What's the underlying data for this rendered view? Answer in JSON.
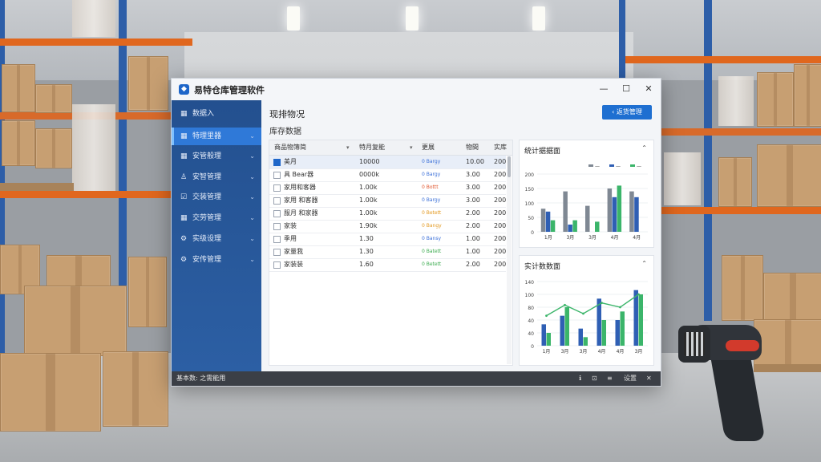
{
  "window": {
    "title": "易特仓库管理软件",
    "controls": [
      "—",
      "☐",
      "✕"
    ]
  },
  "sidebar": {
    "items": [
      {
        "label": "数据入",
        "icon": "grid-icon",
        "active": false
      },
      {
        "label": "特理里器",
        "icon": "grid-icon",
        "active": true
      },
      {
        "label": "安管般理",
        "icon": "grid-icon",
        "active": false
      },
      {
        "label": "安智管理",
        "icon": "user-icon",
        "active": false
      },
      {
        "label": "交装管理",
        "icon": "check-icon",
        "active": false
      },
      {
        "label": "交劳管理",
        "icon": "grid-icon",
        "active": false
      },
      {
        "label": "实级设理",
        "icon": "gear-icon",
        "active": false
      },
      {
        "label": "安传管理",
        "icon": "gear-icon",
        "active": false
      }
    ]
  },
  "main": {
    "title": "现排物况",
    "subtitle": "库存数据",
    "back_button": "返货管理"
  },
  "table": {
    "columns": [
      "商品物簿简",
      "特月复能",
      "更展",
      "物間",
      "实库"
    ],
    "rows": [
      {
        "name": "美月",
        "value": "10000",
        "status": "0 Bargy",
        "status_color": "#3a6fd8",
        "date": "10.00",
        "qty": "200",
        "checked": true
      },
      {
        "name": "具 Bear器",
        "value": "0000k",
        "status": "0 Bargy",
        "status_color": "#3a6fd8",
        "date": "3.00",
        "qty": "200",
        "checked": false
      },
      {
        "name": "家用和客器",
        "value": "1.00k",
        "status": "0 Bottt",
        "status_color": "#e0542c",
        "date": "3.00",
        "qty": "200",
        "checked": false
      },
      {
        "name": "家用 和客器",
        "value": "1.00k",
        "status": "0 Bargy",
        "status_color": "#3a6fd8",
        "date": "3.00",
        "qty": "200",
        "checked": false
      },
      {
        "name": "服月 和家器",
        "value": "1.00k",
        "status": "0 Betett",
        "status_color": "#e39a22",
        "date": "2.00",
        "qty": "200",
        "checked": false
      },
      {
        "name": "家装",
        "value": "1.90k",
        "status": "0 Bangy",
        "status_color": "#e39a22",
        "date": "2.00",
        "qty": "200",
        "checked": false
      },
      {
        "name": "季用",
        "value": "1.30",
        "status": "0 Bansy",
        "status_color": "#3a6fd8",
        "date": "1.00",
        "qty": "200",
        "checked": false
      },
      {
        "name": "家量我",
        "value": "1.30",
        "status": "0 Batett",
        "status_color": "#3bab4f",
        "date": "1.00",
        "qty": "200",
        "checked": false
      },
      {
        "name": "家装装",
        "value": "1.60",
        "status": "0 Betett",
        "status_color": "#3bab4f",
        "date": "2.00",
        "qty": "200",
        "checked": false
      }
    ]
  },
  "statusbar": {
    "text": "基本数: 之需能用",
    "icons": [
      "ℹ",
      "⊡",
      "≡",
      "设置",
      "✕"
    ]
  },
  "charts": {
    "top_title": "统计据据面",
    "bottom_title": "实计数数面"
  },
  "chart_data": [
    {
      "type": "bar",
      "title": "统计据据面",
      "categories": [
        "1月",
        "3月",
        "3月",
        "4月",
        "4月"
      ],
      "ylim": [
        0,
        200
      ],
      "yticks": [
        0,
        50,
        100,
        150,
        200
      ],
      "legend": [
        "—",
        "—",
        "—"
      ],
      "legend_placement": "top-right",
      "series": [
        {
          "color": "#7f8893",
          "values": [
            80,
            140,
            90,
            150,
            140
          ]
        },
        {
          "color": "#2f5fb4",
          "values": [
            70,
            25,
            0,
            120,
            120
          ]
        },
        {
          "color": "#3bb56a",
          "values": [
            40,
            40,
            35,
            160,
            0
          ]
        }
      ]
    },
    {
      "type": "bar+line",
      "title": "实计数数面",
      "categories": [
        "1月",
        "3月",
        "3月",
        "4月",
        "4月",
        "3月"
      ],
      "ylim": [
        0,
        150
      ],
      "yticks": [
        0,
        50,
        100,
        150
      ],
      "ytick_labels": [
        "0",
        "40",
        "40",
        "80",
        "100",
        "140"
      ],
      "series": [
        {
          "color": "#2f5fb4",
          "values": [
            50,
            70,
            40,
            110,
            60,
            130
          ]
        },
        {
          "color": "#3bb56a",
          "values": [
            30,
            90,
            20,
            60,
            80,
            120
          ]
        }
      ],
      "line": {
        "color": "#3bb56a",
        "values": [
          70,
          95,
          75,
          100,
          90,
          120
        ]
      }
    }
  ]
}
